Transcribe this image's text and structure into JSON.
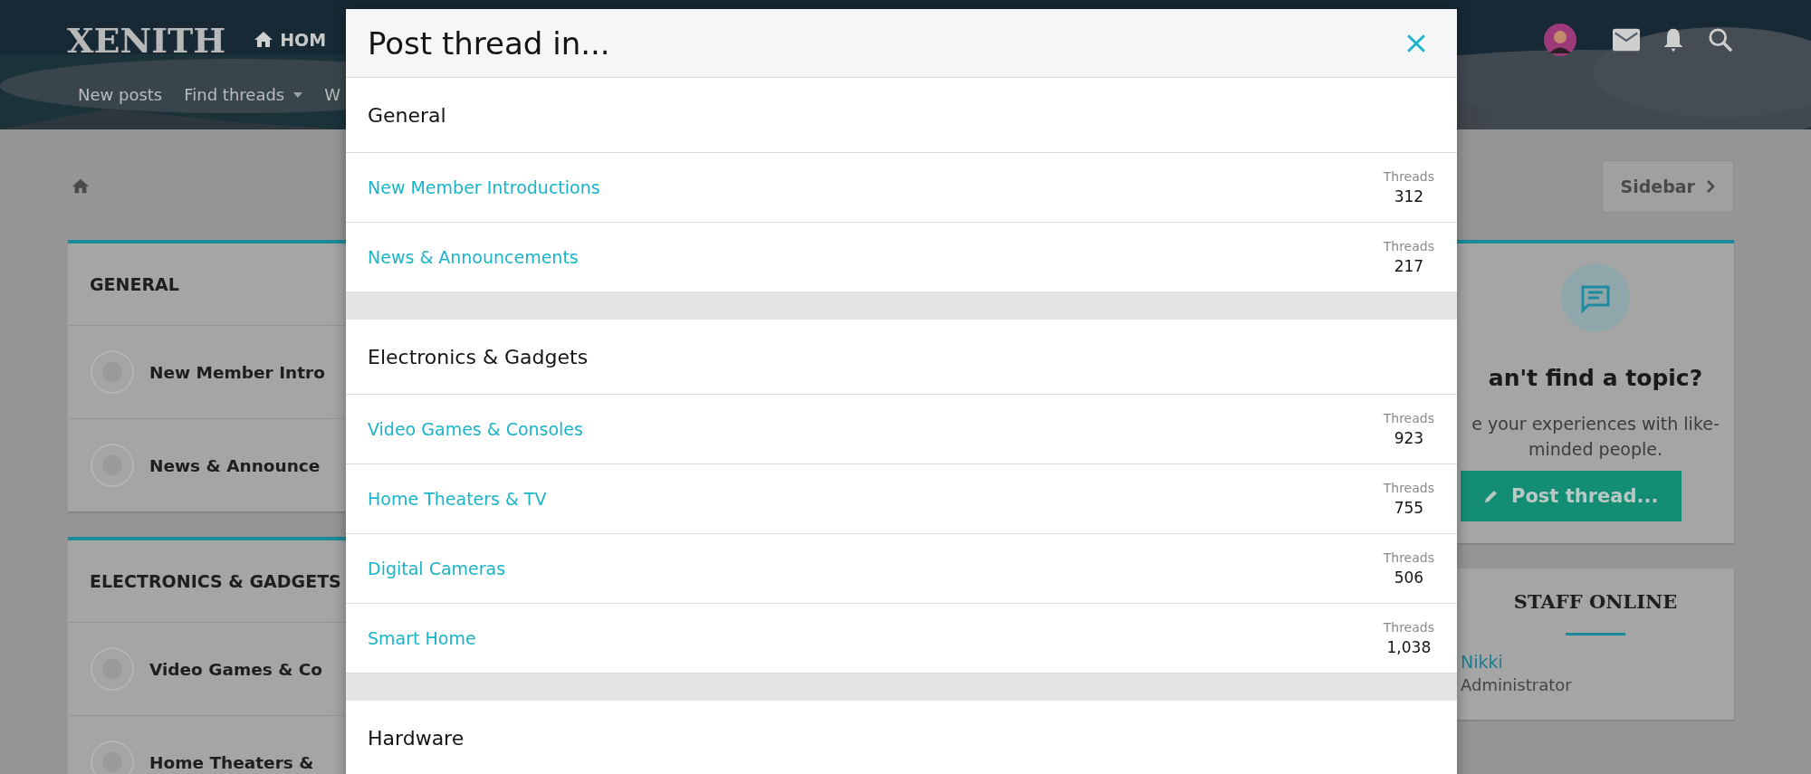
{
  "header": {
    "logo": "XENITH",
    "nav": [
      {
        "label": "HOM"
      }
    ],
    "sub_nav": [
      {
        "label": "New posts",
        "dropdown": false
      },
      {
        "label": "Find threads",
        "dropdown": true
      },
      {
        "label": "W",
        "dropdown": false
      }
    ]
  },
  "sidebar_button": "Sidebar",
  "categories": [
    {
      "title": "GENERAL",
      "forums": [
        "New Member Intro",
        "News & Announce"
      ]
    },
    {
      "title": "ELECTRONICS & GADGETS",
      "forums": [
        "Video Games & Co",
        "Home Theaters &"
      ]
    }
  ],
  "cta": {
    "heading": "an't find a topic?",
    "text_lines": [
      "e your experiences with like-",
      "minded people."
    ],
    "button": "Post thread..."
  },
  "staff_online": {
    "title": "STAFF ONLINE",
    "members": [
      {
        "name": "Nikki",
        "role": "Administrator"
      }
    ]
  },
  "modal": {
    "title": "Post thread in...",
    "sections": [
      {
        "title": "General",
        "forums": [
          {
            "name": "New Member Introductions",
            "stat_label": "Threads",
            "count": "312"
          },
          {
            "name": "News & Announcements",
            "stat_label": "Threads",
            "count": "217"
          }
        ]
      },
      {
        "title": "Electronics & Gadgets",
        "forums": [
          {
            "name": "Video Games & Consoles",
            "stat_label": "Threads",
            "count": "923"
          },
          {
            "name": "Home Theaters & TV",
            "stat_label": "Threads",
            "count": "755"
          },
          {
            "name": "Digital Cameras",
            "stat_label": "Threads",
            "count": "506"
          },
          {
            "name": "Smart Home",
            "stat_label": "Threads",
            "count": "1,038"
          }
        ]
      },
      {
        "title": "Hardware"
      }
    ]
  }
}
